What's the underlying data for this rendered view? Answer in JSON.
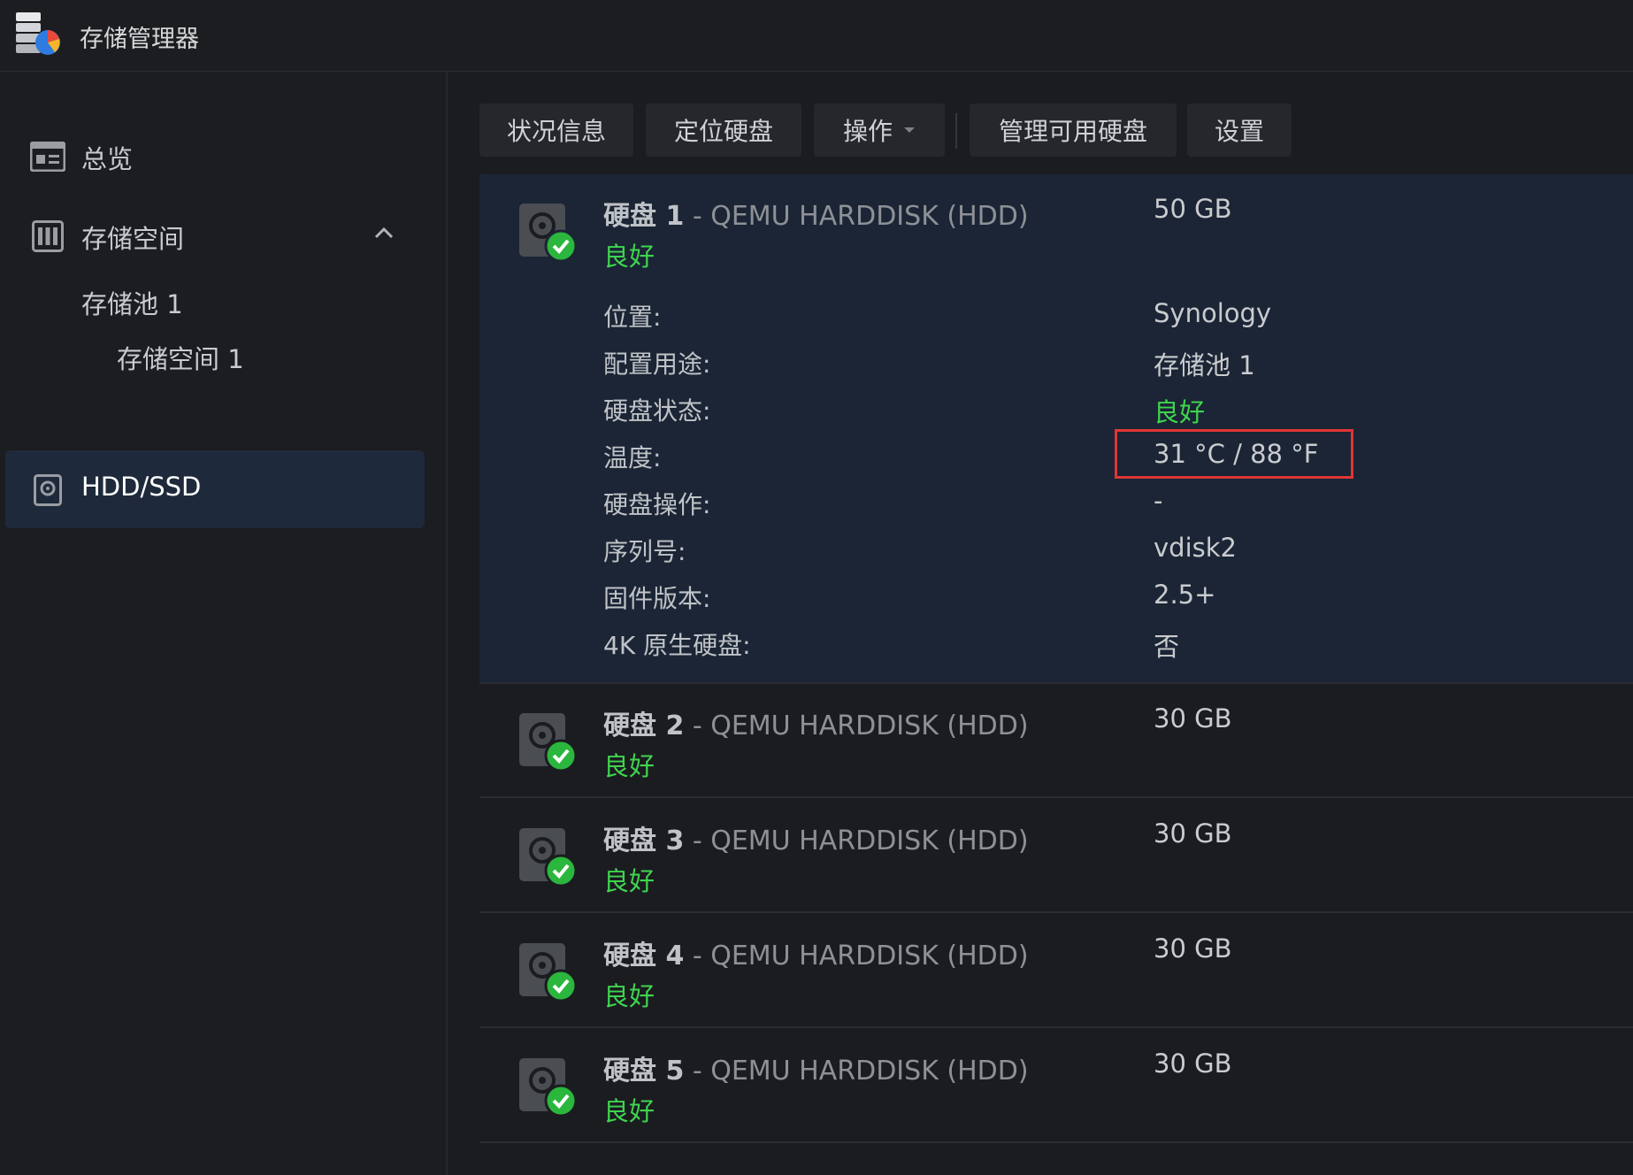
{
  "app": {
    "title": "存储管理器"
  },
  "sidebar": {
    "overview": "总览",
    "storage": "存储空间",
    "pool": "存储池 1",
    "volume": "存储空间 1",
    "hdd": "HDD/SSD"
  },
  "toolbar": {
    "status_info": "状况信息",
    "locate_disk": "定位硬盘",
    "actions": "操作",
    "manage_spare": "管理可用硬盘",
    "settings": "设置"
  },
  "disks": [
    {
      "name": "硬盘 1",
      "model": " - QEMU HARDDISK (HDD)",
      "size": "50 GB",
      "status": "良好"
    },
    {
      "name": "硬盘 2",
      "model": " - QEMU HARDDISK (HDD)",
      "size": "30 GB",
      "status": "良好"
    },
    {
      "name": "硬盘 3",
      "model": " - QEMU HARDDISK (HDD)",
      "size": "30 GB",
      "status": "良好"
    },
    {
      "name": "硬盘 4",
      "model": " - QEMU HARDDISK (HDD)",
      "size": "30 GB",
      "status": "良好"
    },
    {
      "name": "硬盘 5",
      "model": " - QEMU HARDDISK (HDD)",
      "size": "30 GB",
      "status": "良好"
    }
  ],
  "details": [
    {
      "label": "位置:",
      "value": "Synology"
    },
    {
      "label": "配置用途:",
      "value": "存储池 1"
    },
    {
      "label": "硬盘状态:",
      "value": "良好"
    },
    {
      "label": "温度:",
      "value": "31 °C / 88 °F"
    },
    {
      "label": "硬盘操作:",
      "value": "-"
    },
    {
      "label": "序列号:",
      "value": "vdisk2"
    },
    {
      "label": "固件版本:",
      "value": "2.5+"
    },
    {
      "label": "4K 原生硬盘:",
      "value": "否"
    }
  ],
  "colors": {
    "good": "#3fd44f",
    "highlight": "#e03636",
    "selected_bg": "#1e2a3b"
  },
  "icons": {
    "app": "storage-manager-icon",
    "overview": "overview-card-icon",
    "storage": "storage-volume-icon",
    "hdd": "hdd-icon",
    "disk": "disk-ok-icon",
    "collapse": "chevron-up-icon",
    "dropdown": "caret-down-icon"
  }
}
